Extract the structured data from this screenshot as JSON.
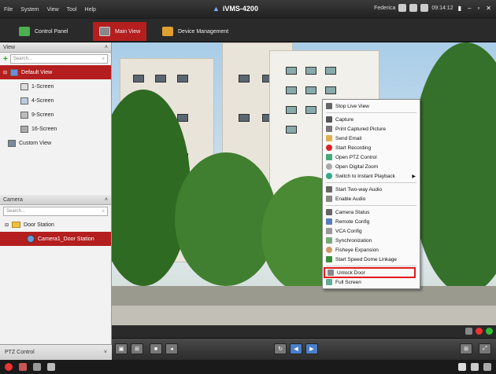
{
  "menubar": {
    "items": [
      "File",
      "System",
      "View",
      "Tool",
      "Help"
    ],
    "app_title": "iVMS-4200",
    "user": "Federica",
    "time": "09:14:12"
  },
  "tabs": [
    {
      "label": "Control Panel"
    },
    {
      "label": "Main View"
    },
    {
      "label": "Device Management"
    }
  ],
  "view_panel": {
    "header": "View",
    "search_placeholder": "Search...",
    "items": [
      "Default View",
      "1-Screen",
      "4-Screen",
      "9-Screen",
      "16-Screen",
      "Custom View"
    ]
  },
  "camera_panel": {
    "header": "Camera",
    "search_placeholder": "Search...",
    "items": [
      "Door Station",
      "Camera1_Door Station"
    ]
  },
  "context_menu": {
    "items": [
      "Stop Live View",
      "Capture",
      "Print Captured Picture",
      "Send Email",
      "Start Recording",
      "Open PTZ Control",
      "Open Digital Zoom",
      "Switch to Instant Playback",
      "Start Two-way Audio",
      "Enable Audio",
      "Camera Status",
      "Remote Config",
      "VCA Config",
      "Synchronization",
      "Fisheye Expansion",
      "Start Speed Dome Linkage",
      "Unlock Door",
      "Full Screen"
    ]
  },
  "ptz_panel": {
    "label": "PTZ Control"
  },
  "colors": {
    "accent": "#b41e1e",
    "highlight_box": "#e21a1a"
  }
}
